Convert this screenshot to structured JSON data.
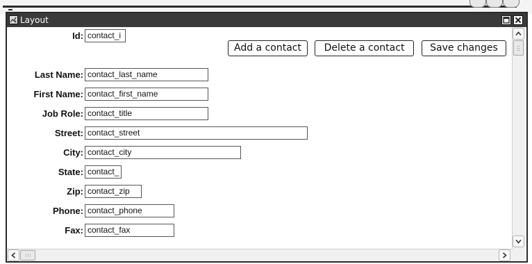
{
  "window": {
    "title": "Layout"
  },
  "fields": [
    {
      "label": "Id:",
      "value": "contact_i"
    },
    {
      "label": "Last Name:",
      "value": "contact_last_name"
    },
    {
      "label": "First Name:",
      "value": "contact_first_name"
    },
    {
      "label": "Job Role:",
      "value": "contact_title"
    },
    {
      "label": "Street:",
      "value": "contact_street"
    },
    {
      "label": "City:",
      "value": "contact_city"
    },
    {
      "label": "State:",
      "value": "contact_"
    },
    {
      "label": "Zip:",
      "value": "contact_zip"
    },
    {
      "label": "Phone:",
      "value": "contact_phone"
    },
    {
      "label": "Fax:",
      "value": "contact_fax"
    }
  ],
  "buttons": {
    "add": "Add a contact",
    "delete": "Delete a contact",
    "save": "Save changes"
  },
  "icons": {
    "app": "layout-window-icon",
    "maximize": "maximize-icon",
    "close": "close-icon",
    "scroll_up": "chevron-up-icon",
    "scroll_down": "chevron-down-icon",
    "scroll_left": "chevron-left-icon",
    "scroll_right": "chevron-right-icon"
  }
}
